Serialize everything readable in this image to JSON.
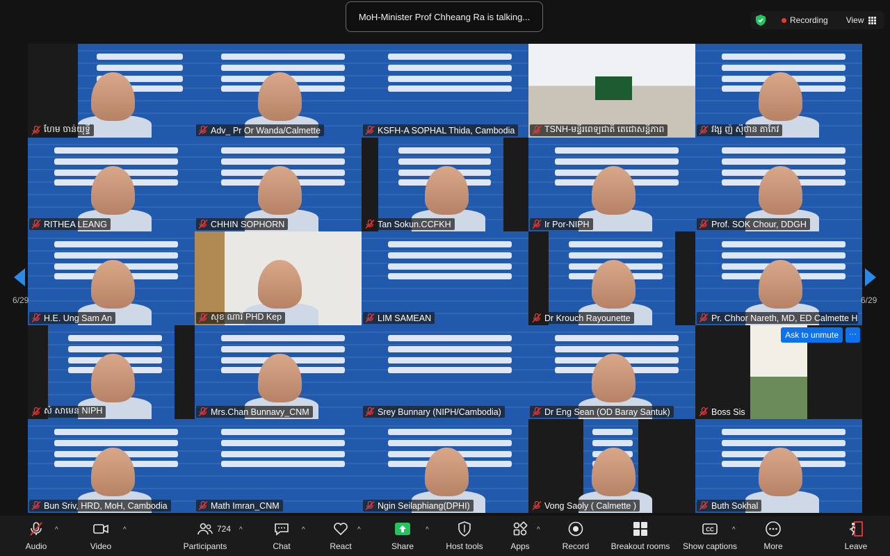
{
  "header": {
    "talking": "MoH-Minister Prof Chheang Ra is talking...",
    "recording": "Recording",
    "view": "View"
  },
  "tiles": [
    {
      "name": "ហែម ចាន់យុទ្ធី"
    },
    {
      "name": "Adv_ Pr Or Wanda/Calmette"
    },
    {
      "name": "KSFH-A SOPHAL Thida, Cambodia"
    },
    {
      "name": "TSNH-មន្ទីរពេទ្យជាតិ តេជោសន្តិភាព"
    },
    {
      "name": "វង្ស ញ៉ ស៊ីថាន តាកែវ"
    },
    {
      "name": "RITHEA LEANG"
    },
    {
      "name": "CHHIN SOPHORN"
    },
    {
      "name": "Tan Sokun.CCFKH"
    },
    {
      "name": "Ir Por-NIPH"
    },
    {
      "name": "Prof. SOK Chour, DDGH"
    },
    {
      "name": "H.E. Ung Sam An"
    },
    {
      "name": "សុខ ណារី PHD Kep"
    },
    {
      "name": "LIM SAMEAN"
    },
    {
      "name": "Dr Krouch Rayounette"
    },
    {
      "name": "Pr. Chhor Nareth, MD, ED Calmette H..."
    },
    {
      "name": "សំ សាមេន NIPH"
    },
    {
      "name": "Mrs.Chan Bunnavy_CNM"
    },
    {
      "name": "Srey Bunnary (NIPH/Cambodia)"
    },
    {
      "name": "Dr Eng Sean (OD Baray Santuk)"
    },
    {
      "name": "Boss Sis"
    },
    {
      "name": "Bun Sriv, HRD, MoH, Cambodia"
    },
    {
      "name": "Math Imran_CNM"
    },
    {
      "name": "Ngin Seilaphiang(DPHI)"
    },
    {
      "name": "Vong Saoly ( Calmette )"
    },
    {
      "name": "Buth Sokhal"
    }
  ],
  "ask_to_unmute": "Ask to unmute",
  "more_dots": "···",
  "pagination": {
    "left": "6/29",
    "right": "6/29"
  },
  "toolbar": {
    "audio": "Audio",
    "video": "Video",
    "participants": "Participants",
    "participants_count": "724",
    "chat": "Chat",
    "react": "React",
    "share": "Share",
    "host_tools": "Host tools",
    "apps": "Apps",
    "record": "Record",
    "breakout": "Breakout rooms",
    "captions": "Show captions",
    "more": "More",
    "leave": "Leave"
  },
  "colors": {
    "accent": "#0e72ed",
    "share": "#23c45e",
    "leave": "#e53935",
    "slide_blue": "#2159ad"
  }
}
